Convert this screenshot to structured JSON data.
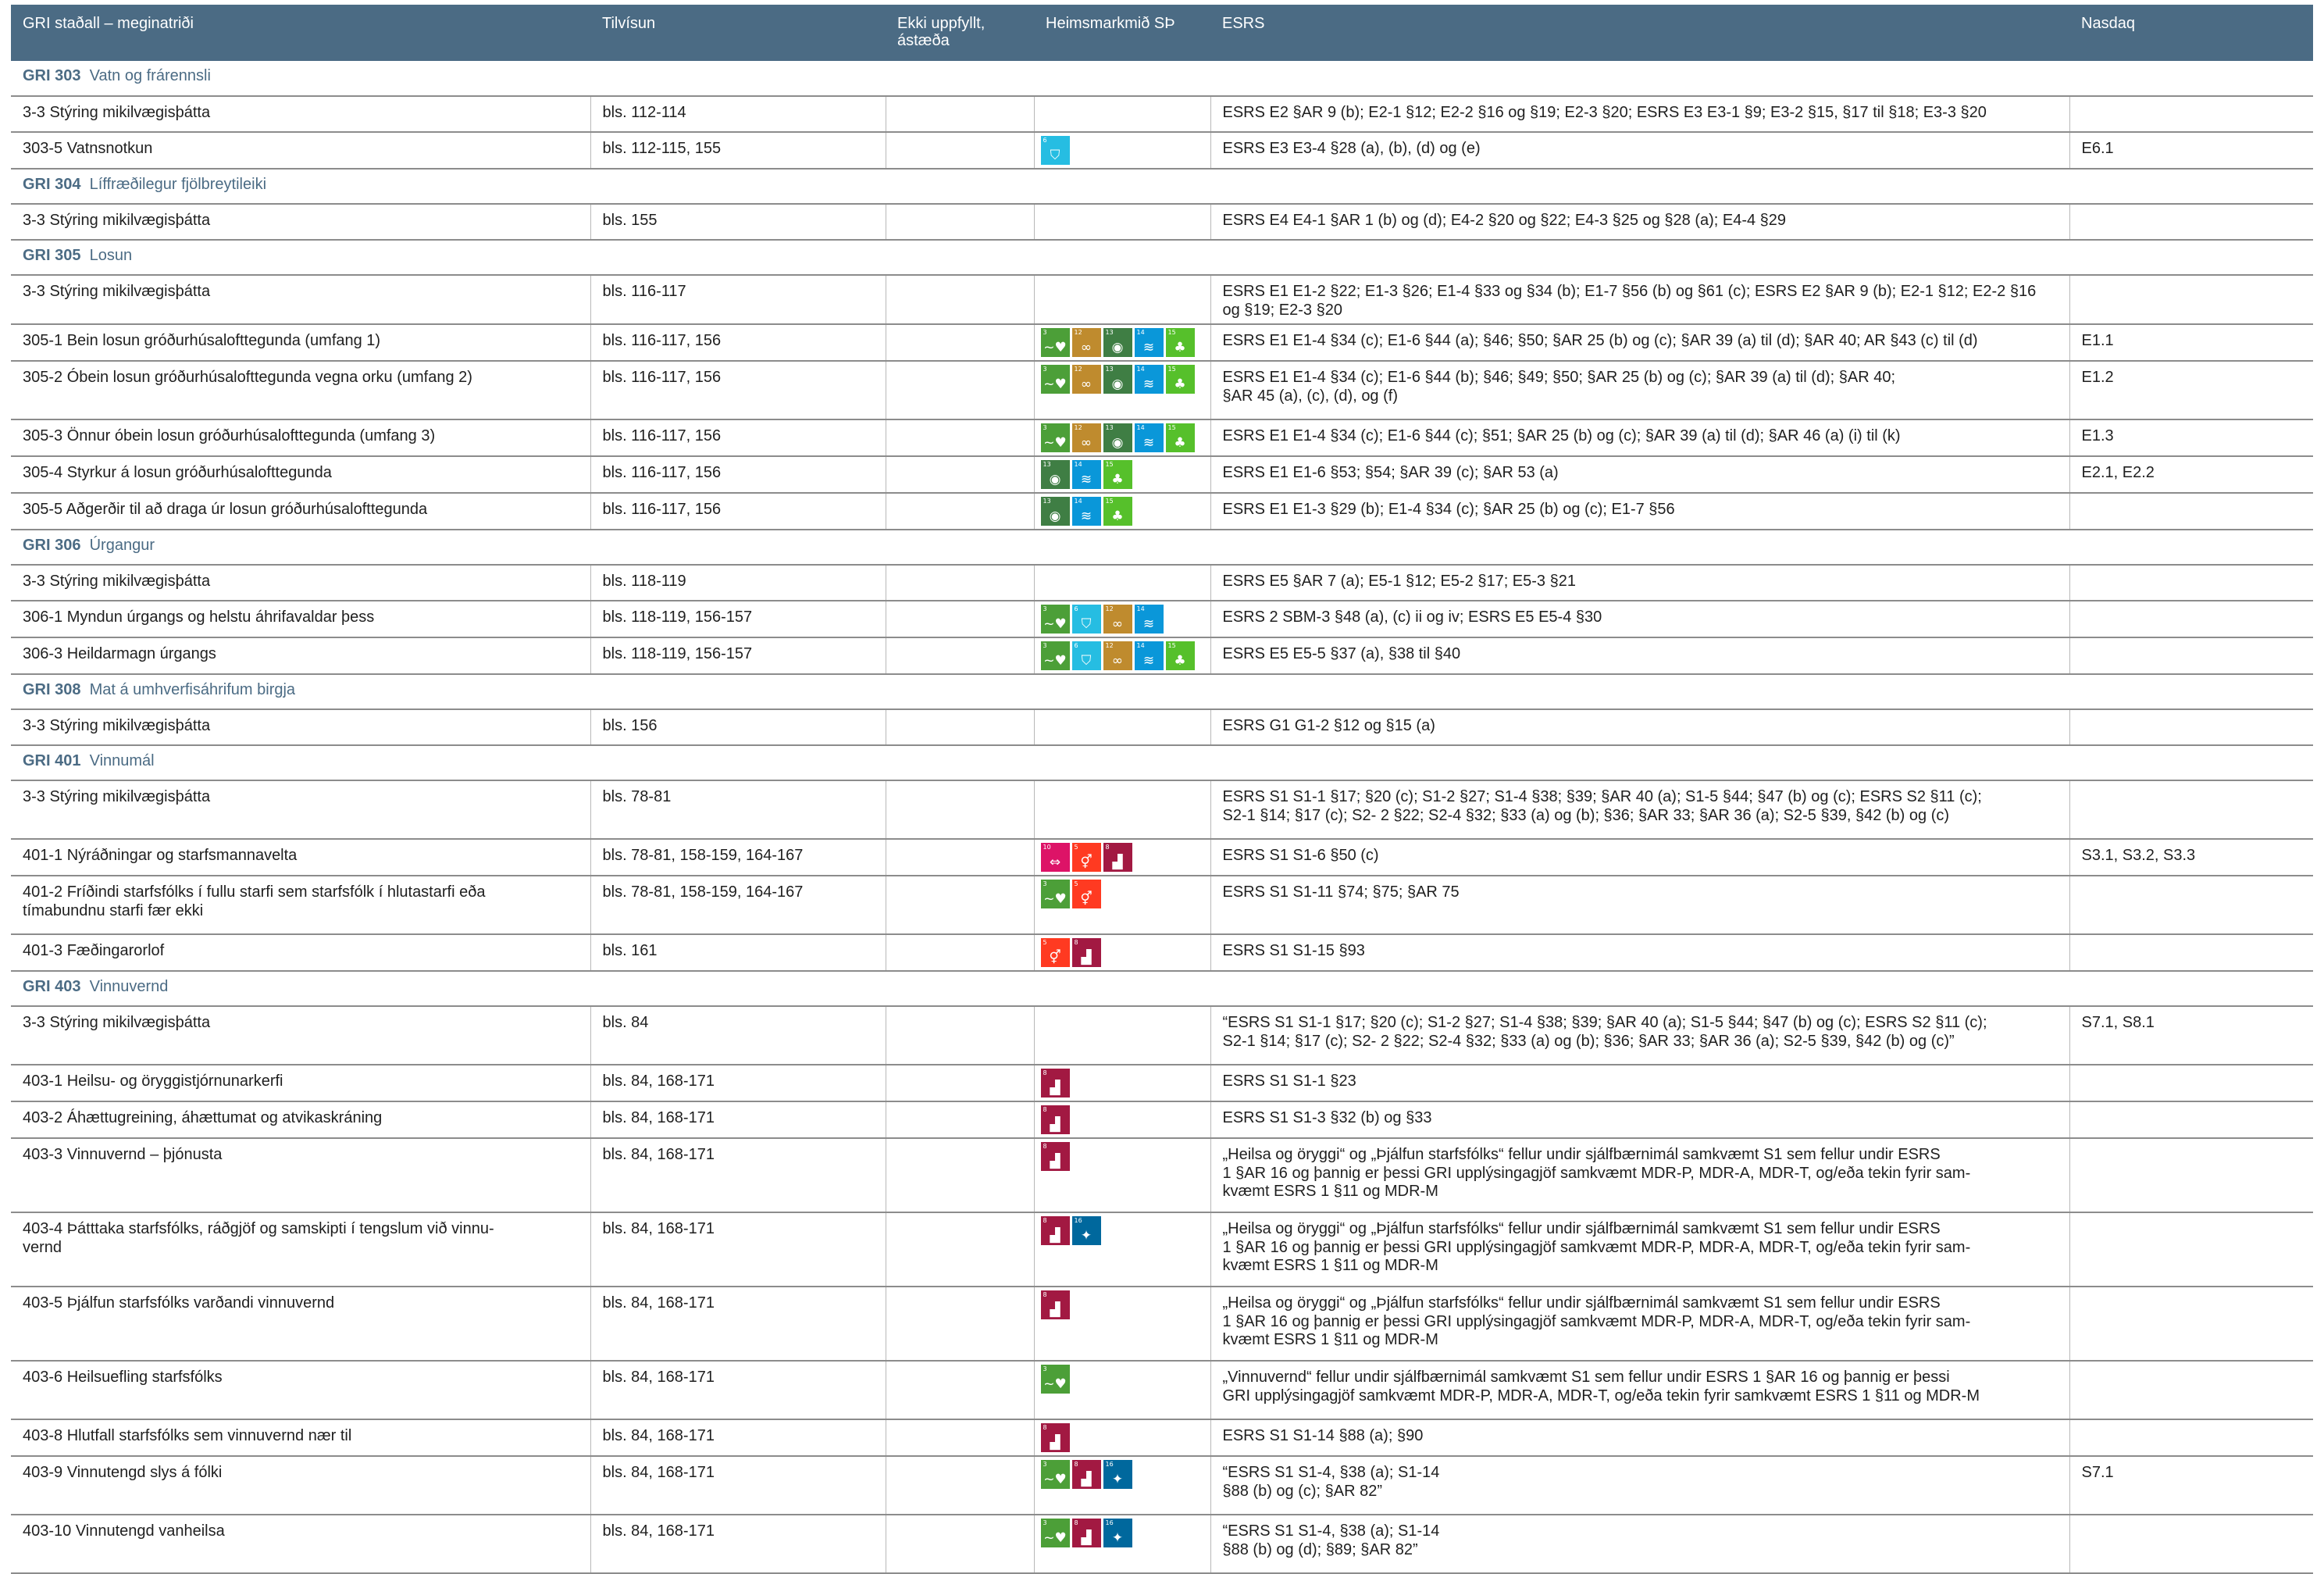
{
  "header": {
    "col1": "GRI staðall – meginatriði",
    "col2": "Tilvísun",
    "col3": "Ekki uppfyllt, ástæða",
    "col4": "Heimsmarkmið SÞ",
    "col5": "ESRS",
    "col6": "Nasdaq"
  },
  "rows": [
    {
      "type": "section",
      "num": "GRI 303",
      "title": "Vatn og frárennsli"
    },
    {
      "type": "data",
      "name": "3-3 Stýring mikilvægisþátta",
      "ref": "bls. 112-114",
      "sdg": [],
      "esrs": "ESRS E2 §AR 9 (b); E2-1 §12; E2-2 §16 og §19; E2-3 §20; ESRS E3 E3-1 §9; E3-2 §15, §17 til §18; E3-3 §20",
      "nasdaq": ""
    },
    {
      "type": "data",
      "name": "303-5 Vatnsnotkun",
      "ref": "bls. 112-115, 155",
      "sdg": [
        "6"
      ],
      "esrs": "ESRS E3 E3-4 §28 (a), (b), (d) og (e)",
      "nasdaq": "E6.1"
    },
    {
      "type": "section",
      "num": "GRI 304",
      "title": "Líffræðilegur fjölbreytileiki"
    },
    {
      "type": "data",
      "name": "3-3 Stýring mikilvægisþátta",
      "ref": "bls. 155",
      "sdg": [],
      "esrs": "ESRS E4 E4-1 §AR 1 (b) og (d); E4-2 §20 og §22; E4-3 §25 og §28 (a); E4-4 §29",
      "nasdaq": ""
    },
    {
      "type": "section",
      "num": "GRI 305",
      "title": "Losun"
    },
    {
      "type": "data",
      "name": "3-3 Stýring mikilvægisþátta",
      "ref": "bls. 116-117",
      "sdg": [],
      "esrs": "ESRS E1 E1-2 §22; E1-3 §26; E1-4 §33 og §34 (b); E1-7 §56 (b) og §61 (c); ESRS E2 §AR 9 (b); E2-1 §12; E2-2 §16 og §19; E2-3 §20",
      "nasdaq": ""
    },
    {
      "type": "data",
      "name": "305-1 Bein losun gróðurhúsalofttegunda (umfang 1)",
      "ref": "bls. 116-117, 156",
      "sdg": [
        "3",
        "12",
        "13",
        "14",
        "15"
      ],
      "esrs": "ESRS E1 E1-4 §34 (c); E1-6 §44 (a); §46; §50; §AR 25 (b) og (c); §AR 39 (a) til (d); §AR 40; AR §43 (c) til (d)",
      "nasdaq": "E1.1"
    },
    {
      "type": "data",
      "name": "305-2 Óbein losun gróðurhúsalofttegunda vegna orku (umfang 2)",
      "ref": "bls. 116-117, 156",
      "sdg": [
        "3",
        "12",
        "13",
        "14",
        "15"
      ],
      "esrs": "ESRS E1 E1-4 §34 (c); E1-6 §44 (b); §46; §49; §50; §AR 25 (b) og (c); §AR 39 (a) til (d); §AR 40;\n§AR 45 (a), (c), (d), og (f)",
      "nasdaq": "E1.2"
    },
    {
      "type": "data",
      "name": "305-3 Önnur óbein losun gróðurhúsalofttegunda (umfang 3)",
      "ref": "bls. 116-117, 156",
      "sdg": [
        "3",
        "12",
        "13",
        "14",
        "15"
      ],
      "esrs": "ESRS E1 E1-4 §34 (c); E1-6 §44 (c); §51; §AR 25 (b) og (c); §AR 39 (a) til (d); §AR 46 (a) (i) til (k)",
      "nasdaq": "E1.3"
    },
    {
      "type": "data",
      "name": "305-4 Styrkur á losun gróðurhúsalofttegunda",
      "ref": "bls. 116-117, 156",
      "sdg": [
        "13",
        "14",
        "15"
      ],
      "esrs": "ESRS E1 E1-6 §53; §54; §AR 39 (c); §AR 53 (a)",
      "nasdaq": "E2.1, E2.2"
    },
    {
      "type": "data",
      "name": "305-5 Aðgerðir til að draga úr losun gróðurhúsalofttegunda",
      "ref": "bls. 116-117, 156",
      "sdg": [
        "13",
        "14",
        "15"
      ],
      "esrs": "ESRS E1 E1-3 §29 (b); E1-4 §34 (c); §AR 25 (b) og (c); E1-7 §56",
      "nasdaq": ""
    },
    {
      "type": "section",
      "num": "GRI 306",
      "title": "Úrgangur"
    },
    {
      "type": "data",
      "name": "3-3 Stýring mikilvægisþátta",
      "ref": "bls. 118-119",
      "sdg": [],
      "esrs": "ESRS E5 §AR 7 (a); E5-1 §12; E5-2 §17; E5-3 §21",
      "nasdaq": ""
    },
    {
      "type": "data",
      "name": "306-1 Myndun úrgangs og helstu áhrifavaldar þess",
      "ref": "bls. 118-119, 156-157",
      "sdg": [
        "3",
        "6",
        "12",
        "14"
      ],
      "esrs": "ESRS 2 SBM-3 §48 (a), (c) ii og iv; ESRS E5 E5-4 §30",
      "nasdaq": ""
    },
    {
      "type": "data",
      "name": "306-3 Heildarmagn úrgangs",
      "ref": "bls. 118-119, 156-157",
      "sdg": [
        "3",
        "6",
        "12",
        "14",
        "15"
      ],
      "esrs": "ESRS E5 E5-5 §37 (a), §38 til §40",
      "nasdaq": ""
    },
    {
      "type": "section",
      "num": "GRI 308",
      "title": "Mat á umhverfisáhrifum birgja"
    },
    {
      "type": "data",
      "name": "3-3 Stýring mikilvægisþátta",
      "ref": "bls. 156",
      "sdg": [],
      "esrs": "ESRS G1 G1-2 §12 og §15 (a)",
      "nasdaq": ""
    },
    {
      "type": "section",
      "num": "GRI 401",
      "title": "Vinnumál"
    },
    {
      "type": "data",
      "name": "3-3 Stýring mikilvægisþátta",
      "ref": "bls. 78-81",
      "sdg": [],
      "esrs": "ESRS S1 S1-1 §17; §20 (c); S1-2 §27; S1-4 §38; §39; §AR 40 (a); S1-5 §44; §47 (b) og (c); ESRS S2 §11 (c);\nS2-1 §14; §17 (c); S2- 2 §22; S2-4 §32; §33 (a) og (b); §36; §AR 33; §AR 36 (a); S2-5 §39, §42 (b) og (c)",
      "nasdaq": ""
    },
    {
      "type": "data",
      "name": "401-1 Nýráðningar og starfsmannavelta",
      "ref": "bls. 78-81, 158-159, 164-167",
      "sdg": [
        "10",
        "5",
        "8"
      ],
      "esrs": "ESRS S1 S1-6 §50 (c)",
      "nasdaq": "S3.1, S3.2, S3.3"
    },
    {
      "type": "data",
      "name": "401-2 Fríðindi starfsfólks í fullu starfi sem starfsfólk í hlutastarfi eða\ntímabundnu starfi fær ekki",
      "ref": "bls. 78-81, 158-159, 164-167",
      "sdg": [
        "3",
        "5"
      ],
      "esrs": "ESRS S1 S1-11 §74; §75; §AR 75",
      "nasdaq": ""
    },
    {
      "type": "data",
      "name": "401-3 Fæðingarorlof",
      "ref": "bls. 161",
      "sdg": [
        "5",
        "8"
      ],
      "esrs": "ESRS S1 S1-15 §93",
      "nasdaq": ""
    },
    {
      "type": "section",
      "num": "GRI 403",
      "title": "Vinnuvernd"
    },
    {
      "type": "data",
      "name": "3-3 Stýring mikilvægisþátta",
      "ref": "bls. 84",
      "sdg": [],
      "esrs": "“ESRS S1 S1-1 §17; §20 (c); S1-2 §27; S1-4 §38; §39; §AR 40 (a); S1-5 §44; §47 (b) og (c); ESRS S2 §11 (c);\nS2-1 §14; §17 (c); S2- 2 §22; S2-4 §32; §33 (a) og (b); §36; §AR 33; §AR 36 (a); S2-5 §39, §42 (b) og (c)”",
      "nasdaq": "S7.1, S8.1"
    },
    {
      "type": "data",
      "name": "403-1 Heilsu- og öryggistjórnunarkerfi",
      "ref": "bls. 84, 168-171",
      "sdg": [
        "8"
      ],
      "esrs": "ESRS S1 S1-1 §23",
      "nasdaq": ""
    },
    {
      "type": "data",
      "name": "403-2 Áhættugreining, áhættumat og atvikaskráning",
      "ref": "bls. 84, 168-171",
      "sdg": [
        "8"
      ],
      "esrs": "ESRS S1 S1-3 §32 (b) og §33",
      "nasdaq": ""
    },
    {
      "type": "data",
      "name": "403-3 Vinnuvernd – þjónusta",
      "ref": "bls. 84, 168-171",
      "sdg": [
        "8"
      ],
      "esrs": "„Heilsa og öryggi“ og „Þjálfun starfsfólks“ fellur undir sjálfbærnimál samkvæmt S1 sem fellur undir ESRS\n1 §AR 16 og þannig er þessi GRI upplýsingagjöf samkvæmt MDR-P, MDR-A, MDR-T, og/eða tekin fyrir sam-\nkvæmt ESRS 1 §11 og MDR-M",
      "nasdaq": ""
    },
    {
      "type": "data",
      "name": "403-4 Þátttaka starfsfólks, ráðgjöf og samskipti í tengslum við vinnu-\nvernd",
      "ref": "bls. 84, 168-171",
      "sdg": [
        "8",
        "16"
      ],
      "esrs": "„Heilsa og öryggi“ og „Þjálfun starfsfólks“ fellur undir sjálfbærnimál samkvæmt S1 sem fellur undir ESRS\n1 §AR 16 og þannig er þessi GRI upplýsingagjöf samkvæmt MDR-P, MDR-A, MDR-T, og/eða tekin fyrir sam-\nkvæmt ESRS 1 §11 og MDR-M",
      "nasdaq": ""
    },
    {
      "type": "data",
      "name": "403-5 Þjálfun starfsfólks varðandi vinnuvernd",
      "ref": "bls. 84, 168-171",
      "sdg": [
        "8"
      ],
      "esrs": "„Heilsa og öryggi“ og „Þjálfun starfsfólks“ fellur undir sjálfbærnimál samkvæmt S1 sem fellur undir ESRS\n1 §AR 16 og þannig er þessi GRI upplýsingagjöf samkvæmt MDR-P, MDR-A, MDR-T, og/eða tekin fyrir sam-\nkvæmt ESRS 1 §11 og MDR-M",
      "nasdaq": ""
    },
    {
      "type": "data",
      "name": "403-6 Heilsuefling starfsfólks",
      "ref": "bls. 84, 168-171",
      "sdg": [
        "3"
      ],
      "esrs": "„Vinnuvernd“ fellur undir sjálfbærnimál samkvæmt S1 sem fellur undir ESRS 1 §AR 16 og þannig er þessi\nGRI upplýsingagjöf samkvæmt MDR-P, MDR-A, MDR-T, og/eða tekin fyrir samkvæmt ESRS 1 §11 og MDR-M",
      "nasdaq": ""
    },
    {
      "type": "data",
      "name": "403-8 Hlutfall starfsfólks sem vinnuvernd nær til",
      "ref": "bls. 84, 168-171",
      "sdg": [
        "8"
      ],
      "esrs": "ESRS S1 S1-14 §88 (a); §90",
      "nasdaq": ""
    },
    {
      "type": "data",
      "name": "403-9 Vinnutengd slys á fólki",
      "ref": "bls. 84, 168-171",
      "sdg": [
        "3",
        "8",
        "16"
      ],
      "esrs": "“ESRS S1 S1-4, §38 (a); S1-14\n§88 (b) og (c); §AR 82”",
      "nasdaq": "S7.1"
    },
    {
      "type": "data",
      "name": "403-10 Vinnutengd vanheilsa",
      "ref": "bls. 84, 168-171",
      "sdg": [
        "3",
        "8",
        "16"
      ],
      "esrs": "“ESRS S1 S1-4, §38 (a); S1-14\n§88 (b) og (d); §89; §AR 82”",
      "nasdaq": ""
    }
  ],
  "sdg_tiles": {
    "3": {
      "color": "#4c9f38",
      "icon": "heartbeat-icon",
      "glyph": "~♥"
    },
    "5": {
      "color": "#ff3a21",
      "icon": "gender-equality-icon",
      "glyph": "⚥"
    },
    "6": {
      "color": "#26bde2",
      "icon": "water-drop-icon",
      "glyph": "⛉"
    },
    "8": {
      "color": "#a21942",
      "icon": "growth-chart-icon",
      "glyph": "▟"
    },
    "10": {
      "color": "#dd1367",
      "icon": "reduced-inequality-icon",
      "glyph": "⇔"
    },
    "12": {
      "color": "#bf8b2e",
      "icon": "infinity-icon",
      "glyph": "∞"
    },
    "13": {
      "color": "#3f7e44",
      "icon": "climate-eye-icon",
      "glyph": "◉"
    },
    "14": {
      "color": "#0a97d9",
      "icon": "fish-icon",
      "glyph": "≋"
    },
    "15": {
      "color": "#56c02b",
      "icon": "tree-icon",
      "glyph": "♣"
    },
    "16": {
      "color": "#00689d",
      "icon": "dove-icon",
      "glyph": "✦"
    }
  }
}
